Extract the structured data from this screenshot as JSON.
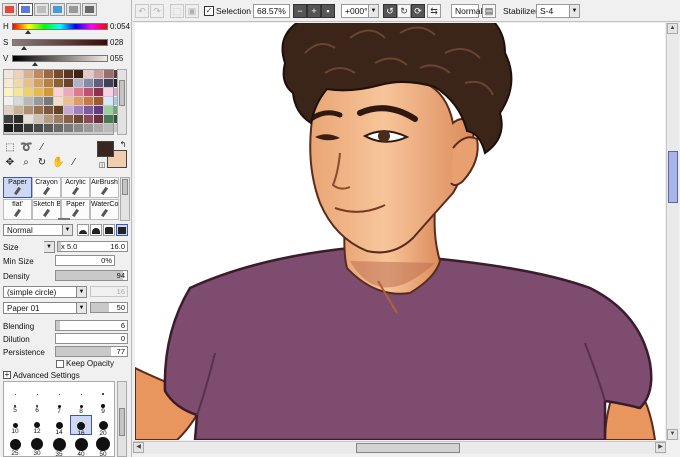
{
  "panel_tabs": [
    {
      "icon": "color-wheel-icon",
      "color": "#e04a3a",
      "selected": false
    },
    {
      "icon": "rgb-slider-icon",
      "color": "#5b7bd6",
      "selected": true
    },
    {
      "icon": "hsv-slider-icon",
      "color": "#bdbdbd",
      "selected": false
    },
    {
      "icon": "color-mixer-icon",
      "color": "#4a9ad8",
      "selected": false
    },
    {
      "icon": "swatches-icon",
      "color": "#999999",
      "selected": false
    },
    {
      "icon": "scratchpad-icon",
      "color": "#6a6a6a",
      "selected": false
    }
  ],
  "hsv": {
    "h": {
      "label": "H",
      "value": "0:054",
      "level": 0.15
    },
    "s": {
      "label": "S",
      "value": "028",
      "level": 0.11
    },
    "v": {
      "label": "V",
      "value": "055",
      "level": 0.22
    }
  },
  "swatches": [
    "#f2e6dc",
    "#ead2bc",
    "#d8b28e",
    "#c08a5e",
    "#9e6844",
    "#7a4a2c",
    "#5a3620",
    "#3e2414",
    "#e8c8c8",
    "#c8a0a0",
    "#9a6e6e",
    "#5e3c3c",
    "#f7ead0",
    "#f0d8a8",
    "#e6c088",
    "#d4a060",
    "#b88040",
    "#8e6030",
    "#6a4428",
    "#b0b0c8",
    "#8888a8",
    "#60607e",
    "#404058",
    "#22222e",
    "#fbf2c4",
    "#f6e49a",
    "#efd070",
    "#e6b850",
    "#d49a30",
    "#fbd0d8",
    "#f0a8b8",
    "#e07890",
    "#c05070",
    "#903050",
    "#f4d4e4",
    "#e0a8c8",
    "#f0f0f0",
    "#d8d8d8",
    "#b8b8b8",
    "#989898",
    "#787878",
    "#f8dcc0",
    "#f0bc90",
    "#e49a64",
    "#c87842",
    "#a05a30",
    "#d8e8f8",
    "#a8c8e8",
    "#e0d0c0",
    "#c8b098",
    "#b09070",
    "#987050",
    "#7e5838",
    "#644428",
    "#c8a8d8",
    "#a080c0",
    "#805aa0",
    "#603c80",
    "#9ad0a0",
    "#68a870",
    "#404040",
    "#2c2c2c",
    "#e8e0d8",
    "#d0c0b0",
    "#b89c84",
    "#a07c60",
    "#886048",
    "#704834",
    "#8a4a5a",
    "#6a3040",
    "#4a7a50",
    "#2c5434",
    "#1a1a1a",
    "#2a2a2a",
    "#3a3a3a",
    "#4a4a4a",
    "#5a5a5a",
    "#6a6a6a",
    "#7a7a7a",
    "#8a8a8a",
    "#9a9a9a",
    "#aaaaaa",
    "#bababa",
    "#cacaca"
  ],
  "colors": {
    "primary": "#3a2620",
    "secondary": "#f1cdb0"
  },
  "tool_icons": [
    "rect-select-icon",
    "lasso-icon",
    "magic-wand-icon",
    "move-icon",
    "zoom-icon",
    "rotate-icon",
    "hand-icon",
    "eyedropper-icon"
  ],
  "brushes": [
    {
      "name": "Paper",
      "selected": true
    },
    {
      "name": "Crayon",
      "selected": false
    },
    {
      "name": "Acrylic",
      "selected": false
    },
    {
      "name": "AirBrush",
      "selected": false
    },
    {
      "name": "flat'",
      "selected": false
    },
    {
      "name": "Sketch B",
      "selected": false
    },
    {
      "name": "Paper",
      "selected": false
    },
    {
      "name": "WaterCo",
      "selected": false
    }
  ],
  "blend_mode": "Normal",
  "props": {
    "size": {
      "label": "Size",
      "prefix": "x 5.0",
      "value": "16.0",
      "level": 0.05
    },
    "min_size": {
      "label": "Min Size",
      "value": "0%",
      "level": 0.0
    },
    "density": {
      "label": "Density",
      "value": "94",
      "level": 0.94
    },
    "shape": "(simple circle)",
    "shape_value": "16",
    "texture": "Paper 01",
    "texture_value": "50",
    "blending": {
      "label": "Blending",
      "value": "6",
      "level": 0.06
    },
    "dilution": {
      "label": "Dilution",
      "value": "0",
      "level": 0.0
    },
    "persistence": {
      "label": "Persistence",
      "value": "77",
      "level": 0.77
    },
    "keep_opacity": "Keep Opacity",
    "advanced": "Advanced Settings"
  },
  "brush_sizes": [
    {
      "label": "2.3",
      "d": 1
    },
    {
      "label": "2.6",
      "d": 1
    },
    {
      "label": "3",
      "d": 1
    },
    {
      "label": "3.5",
      "d": 1
    },
    {
      "label": "4",
      "d": 2
    },
    {
      "label": "5",
      "d": 2
    },
    {
      "label": "6",
      "d": 2
    },
    {
      "label": "7",
      "d": 3
    },
    {
      "label": "8",
      "d": 3
    },
    {
      "label": "9",
      "d": 4
    },
    {
      "label": "10",
      "d": 5
    },
    {
      "label": "12",
      "d": 6
    },
    {
      "label": "14",
      "d": 7
    },
    {
      "label": "16",
      "d": 8,
      "selected": true
    },
    {
      "label": "20",
      "d": 9
    },
    {
      "label": "25",
      "d": 11
    },
    {
      "label": "30",
      "d": 12
    },
    {
      "label": "35",
      "d": 13
    },
    {
      "label": "40",
      "d": 13
    },
    {
      "label": "50",
      "d": 14
    }
  ],
  "toolbar": {
    "selection_label": "Selection",
    "zoom": "68.57%",
    "angle": "+000°",
    "mode": "Normal",
    "stabilizer_label": "Stabilizer",
    "stabilizer_value": "S-4"
  },
  "scroll": {
    "vertical_position": 0.34,
    "horizontal_position": 0.52
  }
}
